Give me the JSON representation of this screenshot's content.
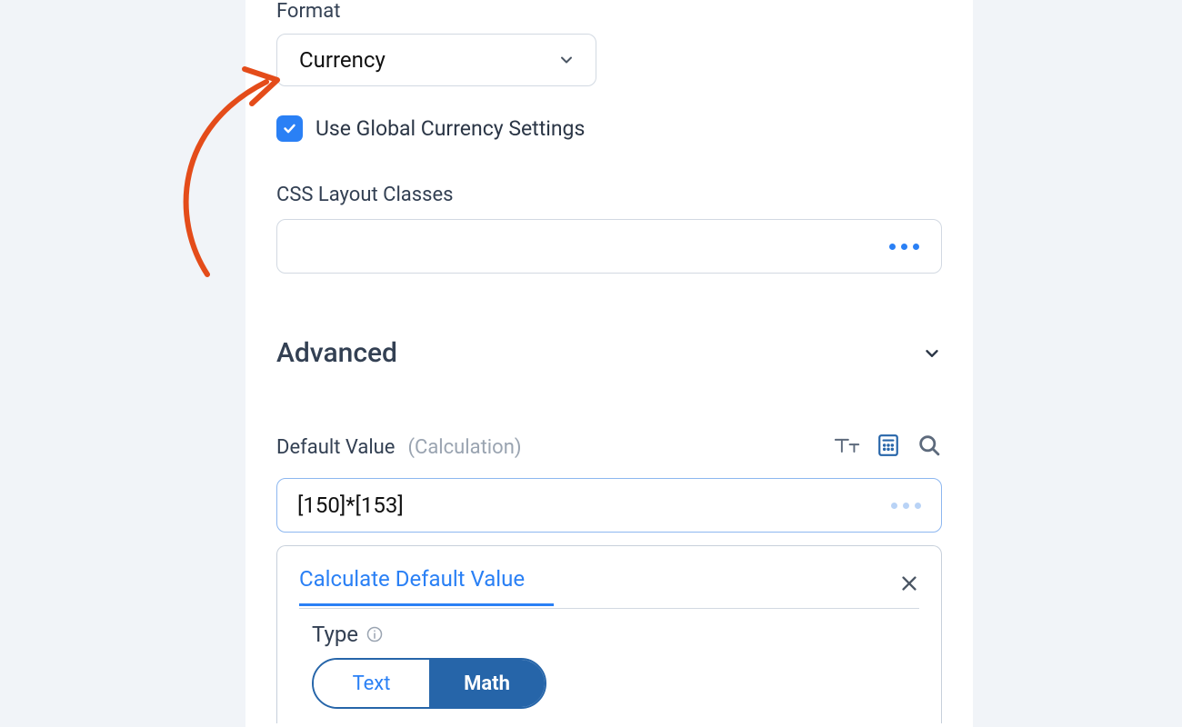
{
  "format": {
    "label": "Format",
    "value": "Currency"
  },
  "global_currency": {
    "label": "Use Global Currency Settings",
    "checked": true
  },
  "css_classes": {
    "label": "CSS Layout Classes",
    "value": ""
  },
  "advanced": {
    "title": "Advanced"
  },
  "default_value": {
    "label": "Default Value",
    "note": "(Calculation)",
    "value": "[150]*[153]"
  },
  "calculate_panel": {
    "tab": "Calculate Default Value",
    "type_label": "Type",
    "options": {
      "text": "Text",
      "math": "Math"
    },
    "selected": "Math"
  },
  "icons": {
    "text": "text-style-icon",
    "calculator": "calculator-icon",
    "search": "search-icon",
    "close": "close-icon",
    "chevron_down": "chevron-down-icon",
    "check": "check-icon",
    "info": "info-icon",
    "more": "more-icon"
  },
  "colors": {
    "accent": "#2a80f5",
    "arrow": "#e44c1a",
    "text": "#2b3646"
  }
}
